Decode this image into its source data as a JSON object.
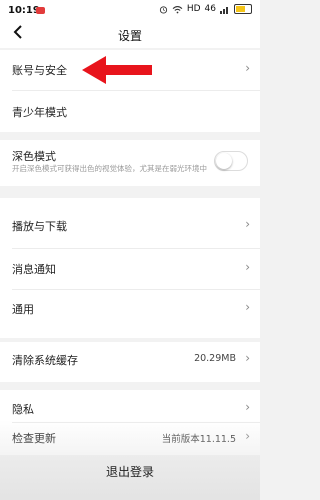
{
  "status_bar": {
    "time": "10:19",
    "network": "HD",
    "signal": "46"
  },
  "header": {
    "title": "设置",
    "back_icon": "chevron-left-icon"
  },
  "rows": {
    "account": {
      "label": "账号与安全"
    },
    "teen": {
      "label": "青少年模式"
    },
    "dark": {
      "label": "深色模式",
      "description": "开启深色模式可获得出色的视觉体验，尤其是在弱光环境中",
      "enabled": false
    },
    "play_download": {
      "label": "播放与下载"
    },
    "notifications": {
      "label": "消息通知"
    },
    "general": {
      "label": "通用"
    },
    "clear_cache": {
      "label": "清除系统缓存",
      "value": "20.29MB"
    },
    "privacy": {
      "label": "隐私"
    },
    "update": {
      "label": "检查更新",
      "value": "当前版本11.11.5"
    }
  },
  "logout_label": "退出登录",
  "chevron_glyph": "›",
  "annotation": {
    "color": "#e8141c",
    "icon": "arrow-left-icon"
  }
}
